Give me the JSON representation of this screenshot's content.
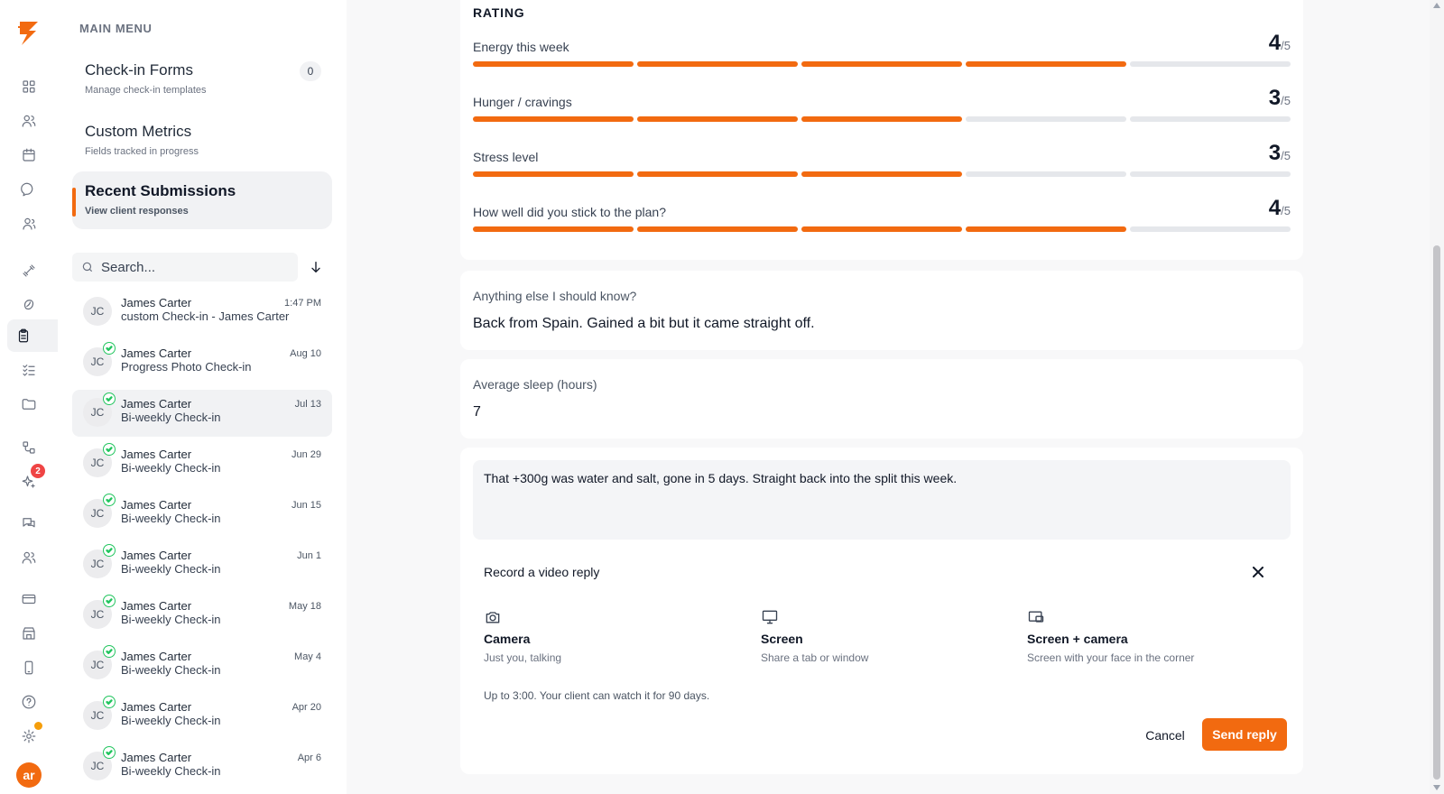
{
  "sidebar": {
    "menu_title": "MAIN MENU",
    "items": [
      {
        "title": "Check-in Forms",
        "subtitle": "Manage check-in templates",
        "count": "0"
      },
      {
        "title": "Custom Metrics",
        "subtitle": "Fields tracked in progress"
      },
      {
        "title": "Recent Submissions",
        "subtitle": "View client responses"
      }
    ],
    "search_placeholder": "Search...",
    "submissions": [
      {
        "initials": "JC",
        "name": "James Carter",
        "title": "custom Check-in - James Carter",
        "date": "1:47 PM",
        "reviewed": false
      },
      {
        "initials": "JC",
        "name": "James Carter",
        "title": "Progress Photo Check-in",
        "date": "Aug 10",
        "reviewed": true
      },
      {
        "initials": "JC",
        "name": "James Carter",
        "title": "Bi-weekly Check-in",
        "date": "Jul 13",
        "reviewed": true
      },
      {
        "initials": "JC",
        "name": "James Carter",
        "title": "Bi-weekly Check-in",
        "date": "Jun 29",
        "reviewed": true
      },
      {
        "initials": "JC",
        "name": "James Carter",
        "title": "Bi-weekly Check-in",
        "date": "Jun 15",
        "reviewed": true
      },
      {
        "initials": "JC",
        "name": "James Carter",
        "title": "Bi-weekly Check-in",
        "date": "Jun 1",
        "reviewed": true
      },
      {
        "initials": "JC",
        "name": "James Carter",
        "title": "Bi-weekly Check-in",
        "date": "May 18",
        "reviewed": true
      },
      {
        "initials": "JC",
        "name": "James Carter",
        "title": "Bi-weekly Check-in",
        "date": "May 4",
        "reviewed": true
      },
      {
        "initials": "JC",
        "name": "James Carter",
        "title": "Bi-weekly Check-in",
        "date": "Apr 20",
        "reviewed": true
      },
      {
        "initials": "JC",
        "name": "James Carter",
        "title": "Bi-weekly Check-in",
        "date": "Apr 6",
        "reviewed": true
      }
    ]
  },
  "rail": {
    "notification_count": "2",
    "user_initials": "ar",
    "icons": [
      "grid-icon",
      "users-icon",
      "calendar-icon",
      "chat-icon",
      "team-icon",
      "dumbbell-icon",
      "nutrition-icon",
      "clipboard-icon",
      "checklist-icon",
      "folder-icon",
      "workflow-icon",
      "sparkle-icon",
      "messages-icon",
      "community-icon",
      "card-icon",
      "store-icon",
      "mobile-icon",
      "help-icon",
      "gear-icon"
    ]
  },
  "rating": {
    "title": "RATING",
    "max_label": "/5",
    "rows": [
      {
        "label": "Energy this week",
        "value": "4",
        "score": 4
      },
      {
        "label": "Hunger / cravings",
        "value": "3",
        "score": 3
      },
      {
        "label": "Stress level",
        "value": "3",
        "score": 3
      },
      {
        "label": "How well did you stick to the plan?",
        "value": "4",
        "score": 4
      }
    ]
  },
  "answers": [
    {
      "question": "Anything else I should know?",
      "answer": "Back from Spain. Gained a bit but it came straight off."
    },
    {
      "question": "Average sleep (hours)",
      "answer": "7"
    }
  ],
  "reply": {
    "text": "That +300g was water and salt, gone in 5 days. Straight back into the split this week.",
    "video_title": "Record a video reply",
    "options": [
      {
        "title": "Camera",
        "subtitle": "Just you, talking"
      },
      {
        "title": "Screen",
        "subtitle": "Share a tab or window"
      },
      {
        "title": "Screen + camera",
        "subtitle": "Screen with your face in the corner"
      }
    ],
    "note": "Up to 3:00. Your client can watch it for 90 days.",
    "cancel_label": "Cancel",
    "send_label": "Send reply"
  },
  "colors": {
    "accent": "#f26a10",
    "success": "#22c55e",
    "badge": "#ef4444"
  }
}
